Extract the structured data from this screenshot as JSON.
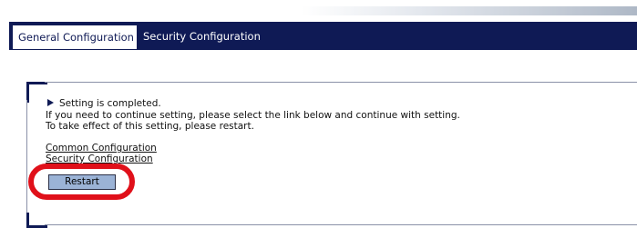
{
  "tabs": [
    {
      "label": "General Configuration",
      "active": true
    },
    {
      "label": "Security Configuration",
      "active": false
    }
  ],
  "message": {
    "status": "Setting is completed.",
    "line1": "If you need to continue setting, please select the link below and continue with setting.",
    "line2": "To take effect of this setting, please restart."
  },
  "links": {
    "common": "Common Configuration",
    "security": "Security Configuration"
  },
  "restart_button": {
    "label": "Restart"
  },
  "colors": {
    "navy": "#0f1a55",
    "button": "#9bb3d6",
    "highlight": "#e0101a"
  }
}
